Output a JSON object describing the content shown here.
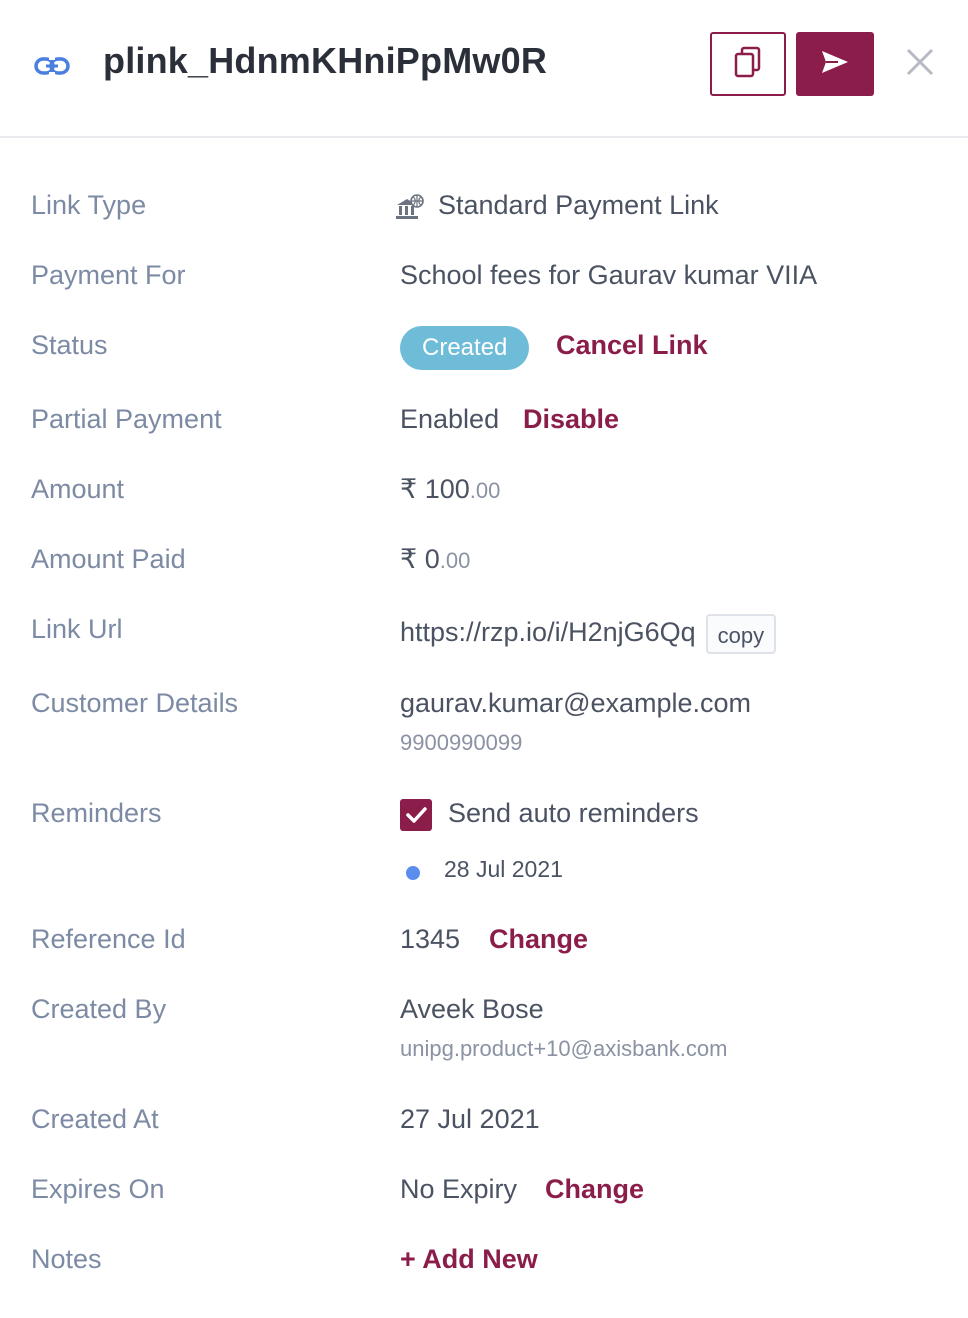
{
  "header": {
    "title": "plink_HdnmKHniPpMw0R",
    "icons": {
      "link": "link-icon",
      "copy": "copy-icon",
      "send": "send-icon",
      "close": "close-icon"
    }
  },
  "colors": {
    "accent": "#8b1d4b",
    "badge": "#6fbcd9",
    "label": "#7c8aa4",
    "dot": "#5b8def"
  },
  "details": {
    "link_type": {
      "label": "Link Type",
      "value": "Standard Payment Link",
      "icon": "bank-globe-icon"
    },
    "payment_for": {
      "label": "Payment For",
      "value": "School fees for Gaurav kumar VIIA"
    },
    "status": {
      "label": "Status",
      "badge": "Created",
      "action": "Cancel Link"
    },
    "partial_payment": {
      "label": "Partial Payment",
      "value": "Enabled",
      "action": "Disable"
    },
    "amount": {
      "label": "Amount",
      "currency": "₹",
      "whole": "100",
      "decimal": ".00"
    },
    "amount_paid": {
      "label": "Amount Paid",
      "currency": "₹",
      "whole": "0",
      "decimal": ".00"
    },
    "link_url": {
      "label": "Link Url",
      "value": "https://rzp.io/i/H2njG6Qq",
      "copy_label": "copy"
    },
    "customer": {
      "label": "Customer Details",
      "email": "gaurav.kumar@example.com",
      "phone": "9900990099"
    },
    "reminders": {
      "label": "Reminders",
      "checkbox_label": "Send auto reminders",
      "checked": true,
      "date": "28 Jul 2021"
    },
    "reference": {
      "label": "Reference Id",
      "value": "1345",
      "action": "Change"
    },
    "created_by": {
      "label": "Created By",
      "name": "Aveek Bose",
      "email": "unipg.product+10@axisbank.com"
    },
    "created_at": {
      "label": "Created At",
      "value": "27 Jul 2021"
    },
    "expires": {
      "label": "Expires On",
      "value": "No Expiry",
      "action": "Change"
    },
    "notes": {
      "label": "Notes",
      "action": "+ Add New"
    }
  }
}
